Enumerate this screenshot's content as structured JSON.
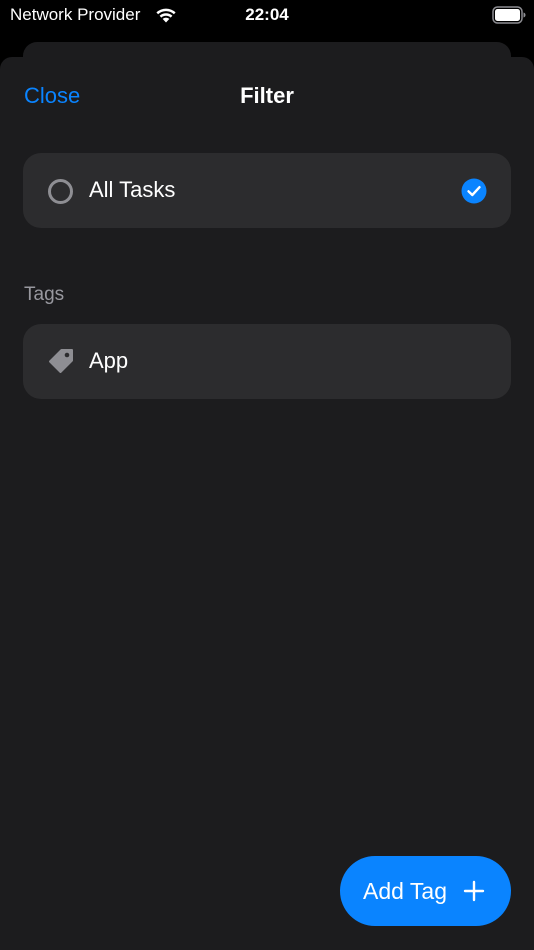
{
  "status_bar": {
    "carrier": "Network Provider",
    "time": "22:04",
    "wifi_icon": "wifi-icon",
    "battery_icon": "battery-icon"
  },
  "nav": {
    "close_label": "Close",
    "title": "Filter"
  },
  "filters": {
    "all_tasks": {
      "label": "All Tasks",
      "icon": "radio-circle-icon",
      "selected": true,
      "check_icon": "checkmark-circle-icon"
    }
  },
  "tags_section": {
    "header": "Tags",
    "items": [
      {
        "label": "App",
        "icon": "tag-icon"
      }
    ]
  },
  "add_tag_button": {
    "label": "Add Tag",
    "icon": "plus-icon"
  },
  "colors": {
    "accent": "#0a84ff",
    "sheet_background": "#1c1c1e",
    "row_background": "#2c2c2e",
    "secondary_text": "#98989f"
  }
}
